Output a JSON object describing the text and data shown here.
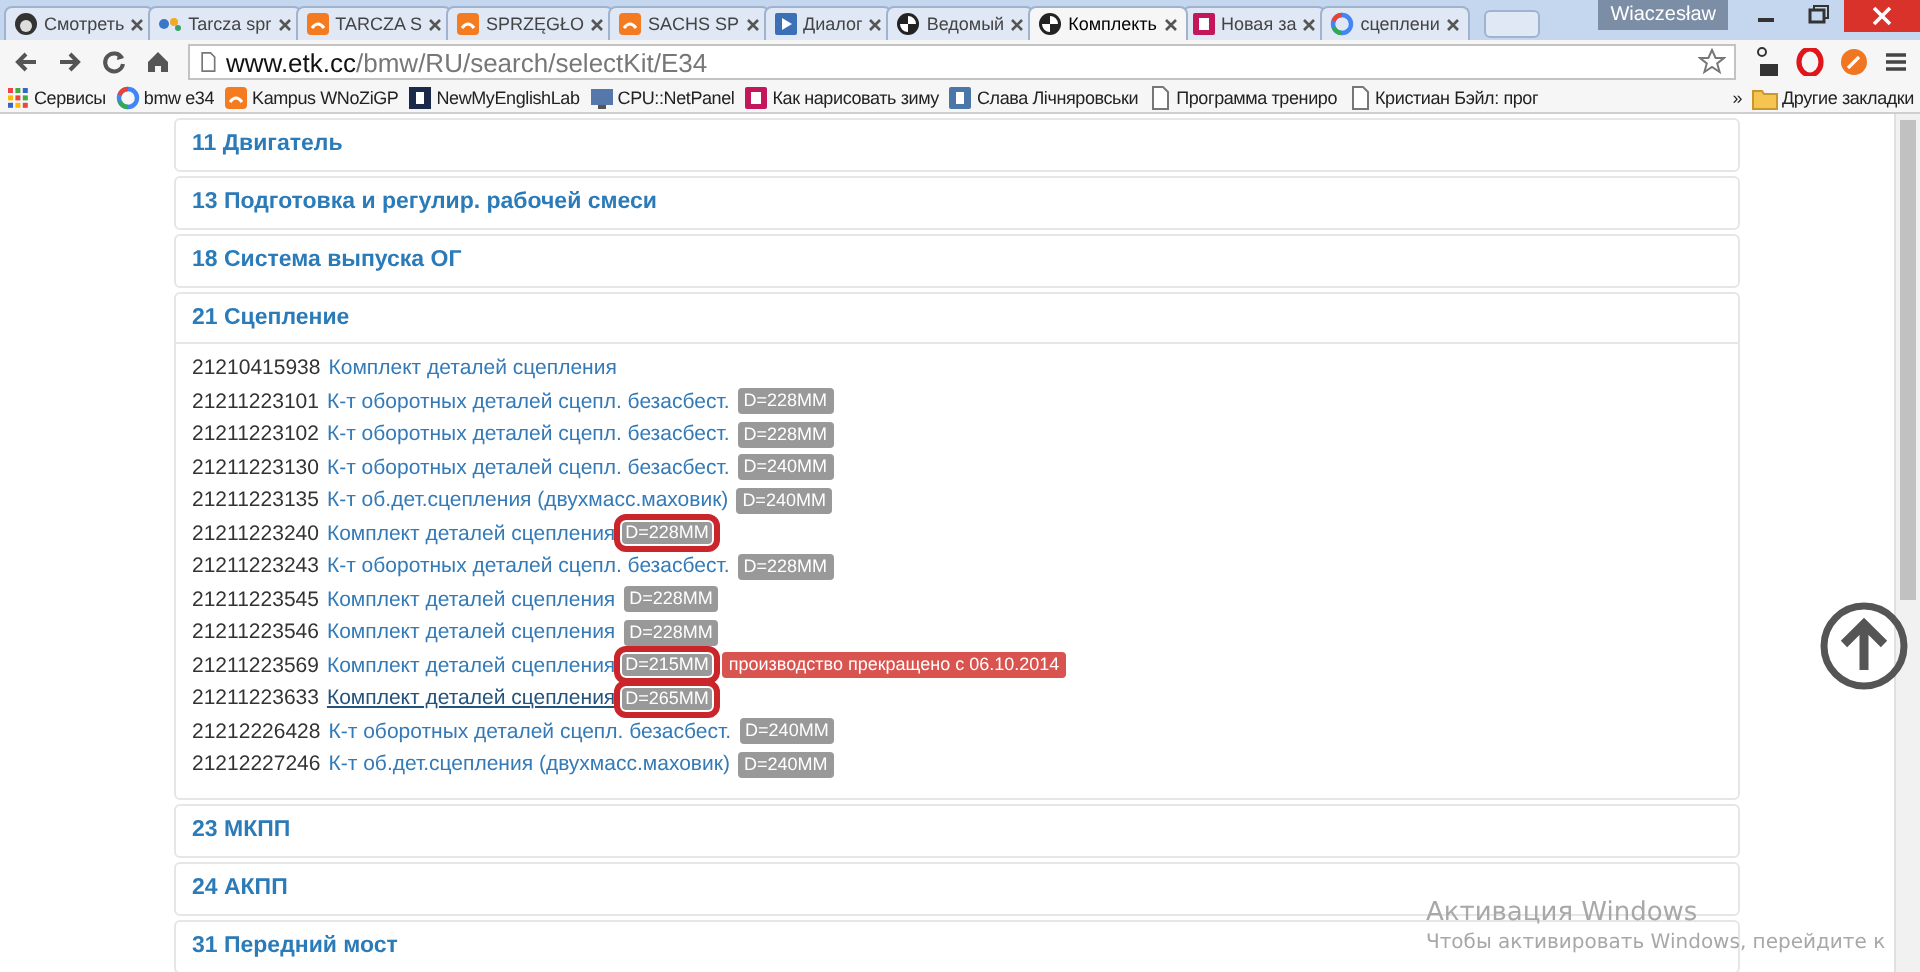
{
  "browser": {
    "tabs": [
      {
        "title": "Смотреть",
        "kind": "face",
        "selected": false
      },
      {
        "title": "Tarcza spr",
        "kind": "dots",
        "selected": false
      },
      {
        "title": "TARCZA S",
        "kind": "orange",
        "selected": false
      },
      {
        "title": "SPRZĘGŁO",
        "kind": "orange",
        "selected": false
      },
      {
        "title": "SACHS SP",
        "kind": "orange",
        "selected": false
      },
      {
        "title": "Диалог",
        "kind": "play",
        "selected": false
      },
      {
        "title": "Ведомый",
        "kind": "roundel",
        "selected": false
      },
      {
        "title": "Комплекть",
        "kind": "roundel",
        "selected": true
      },
      {
        "title": "Новая за",
        "kind": "pink",
        "selected": false
      },
      {
        "title": "сцеплени",
        "kind": "google",
        "selected": false
      }
    ],
    "user": "Wiaczesław",
    "address": {
      "host": "www.etk.cc",
      "path": "/bmw/RU/search/selectKit/E34"
    },
    "bookmarks": [
      {
        "label": "Сервисы",
        "kind": "grid"
      },
      {
        "label": "bmw e34",
        "kind": "google"
      },
      {
        "label": "Kampus WNoZiGP",
        "kind": "orange"
      },
      {
        "label": "NewMyEnglishLab",
        "kind": "dark"
      },
      {
        "label": "CPU::NetPanel",
        "kind": "screen"
      },
      {
        "label": "Как нарисовать зиму",
        "kind": "pink"
      },
      {
        "label": "Слава Лічняровськи",
        "kind": "blue"
      },
      {
        "label": "Программа трениро",
        "kind": "page"
      },
      {
        "label": "Кристиан Бэйл: прог",
        "kind": "page"
      }
    ],
    "more": "»",
    "other_bookmarks": "Другие закладки"
  },
  "sections": [
    {
      "title": "11 Двигатель",
      "expanded": false
    },
    {
      "title": "13 Подготовка и регулир. рабочей смеси",
      "expanded": false
    },
    {
      "title": "18 Система выпуска ОГ",
      "expanded": false
    },
    {
      "title": "21 Сцепление",
      "expanded": true,
      "items": [
        {
          "number": "21210415938",
          "title": "Комплект деталей сцепления",
          "hovered": false
        },
        {
          "number": "21211223101",
          "title": "К-т оборотных деталей сцепл. безасбест.",
          "hovered": false,
          "badges": [
            {
              "text": "D=228MM",
              "kind": "size",
              "highlighted": false
            }
          ]
        },
        {
          "number": "21211223102",
          "title": "К-т оборотных деталей сцепл. безасбест.",
          "hovered": false,
          "badges": [
            {
              "text": "D=228MM",
              "kind": "size",
              "highlighted": false
            }
          ]
        },
        {
          "number": "21211223130",
          "title": "К-т оборотных деталей сцепл. безасбест.",
          "hovered": false,
          "badges": [
            {
              "text": "D=240MM",
              "kind": "size",
              "highlighted": false
            }
          ]
        },
        {
          "number": "21211223135",
          "title": "К-т об.дет.сцепления (двухмасс.маховик)",
          "hovered": false,
          "badges": [
            {
              "text": "D=240MM",
              "kind": "size",
              "highlighted": false
            }
          ]
        },
        {
          "number": "21211223240",
          "title": "Комплект деталей сцепления",
          "hovered": false,
          "badges": [
            {
              "text": "D=228MM",
              "kind": "size",
              "highlighted": true
            }
          ]
        },
        {
          "number": "21211223243",
          "title": "К-т оборотных деталей сцепл. безасбест.",
          "hovered": false,
          "badges": [
            {
              "text": "D=228MM",
              "kind": "size",
              "highlighted": false
            }
          ]
        },
        {
          "number": "21211223545",
          "title": "Комплект деталей сцепления",
          "hovered": false,
          "badges": [
            {
              "text": "D=228MM",
              "kind": "size",
              "highlighted": false
            }
          ]
        },
        {
          "number": "21211223546",
          "title": "Комплект деталей сцепления",
          "hovered": false,
          "badges": [
            {
              "text": "D=228MM",
              "kind": "size",
              "highlighted": false
            }
          ]
        },
        {
          "number": "21211223569",
          "title": "Комплект деталей сцепления",
          "hovered": false,
          "badges": [
            {
              "text": "D=215MM",
              "kind": "size",
              "highlighted": true
            },
            {
              "text": "производство прекращено с 06.10.2014",
              "kind": "warning",
              "highlighted": false
            }
          ]
        },
        {
          "number": "21211223633",
          "title": "Комплект деталей сцепления",
          "hovered": true,
          "badges": [
            {
              "text": "D=265MM",
              "kind": "size",
              "highlighted": true
            }
          ]
        },
        {
          "number": "21212226428",
          "title": "К-т оборотных деталей сцепл. безасбест.",
          "hovered": false,
          "badges": [
            {
              "text": "D=240MM",
              "kind": "size",
              "highlighted": false
            }
          ]
        },
        {
          "number": "21212227246",
          "title": "К-т об.дет.сцепления (двухмасс.маховик)",
          "hovered": false,
          "badges": [
            {
              "text": "D=240MM",
              "kind": "size",
              "highlighted": false
            }
          ]
        }
      ]
    },
    {
      "title": "23 МКПП",
      "expanded": false
    },
    {
      "title": "24 АКПП",
      "expanded": false
    },
    {
      "title": "31 Передний мост",
      "expanded": false
    }
  ],
  "activation": {
    "title": "Активация Windows",
    "text": "Чтобы активировать Windows, перейдите к"
  }
}
